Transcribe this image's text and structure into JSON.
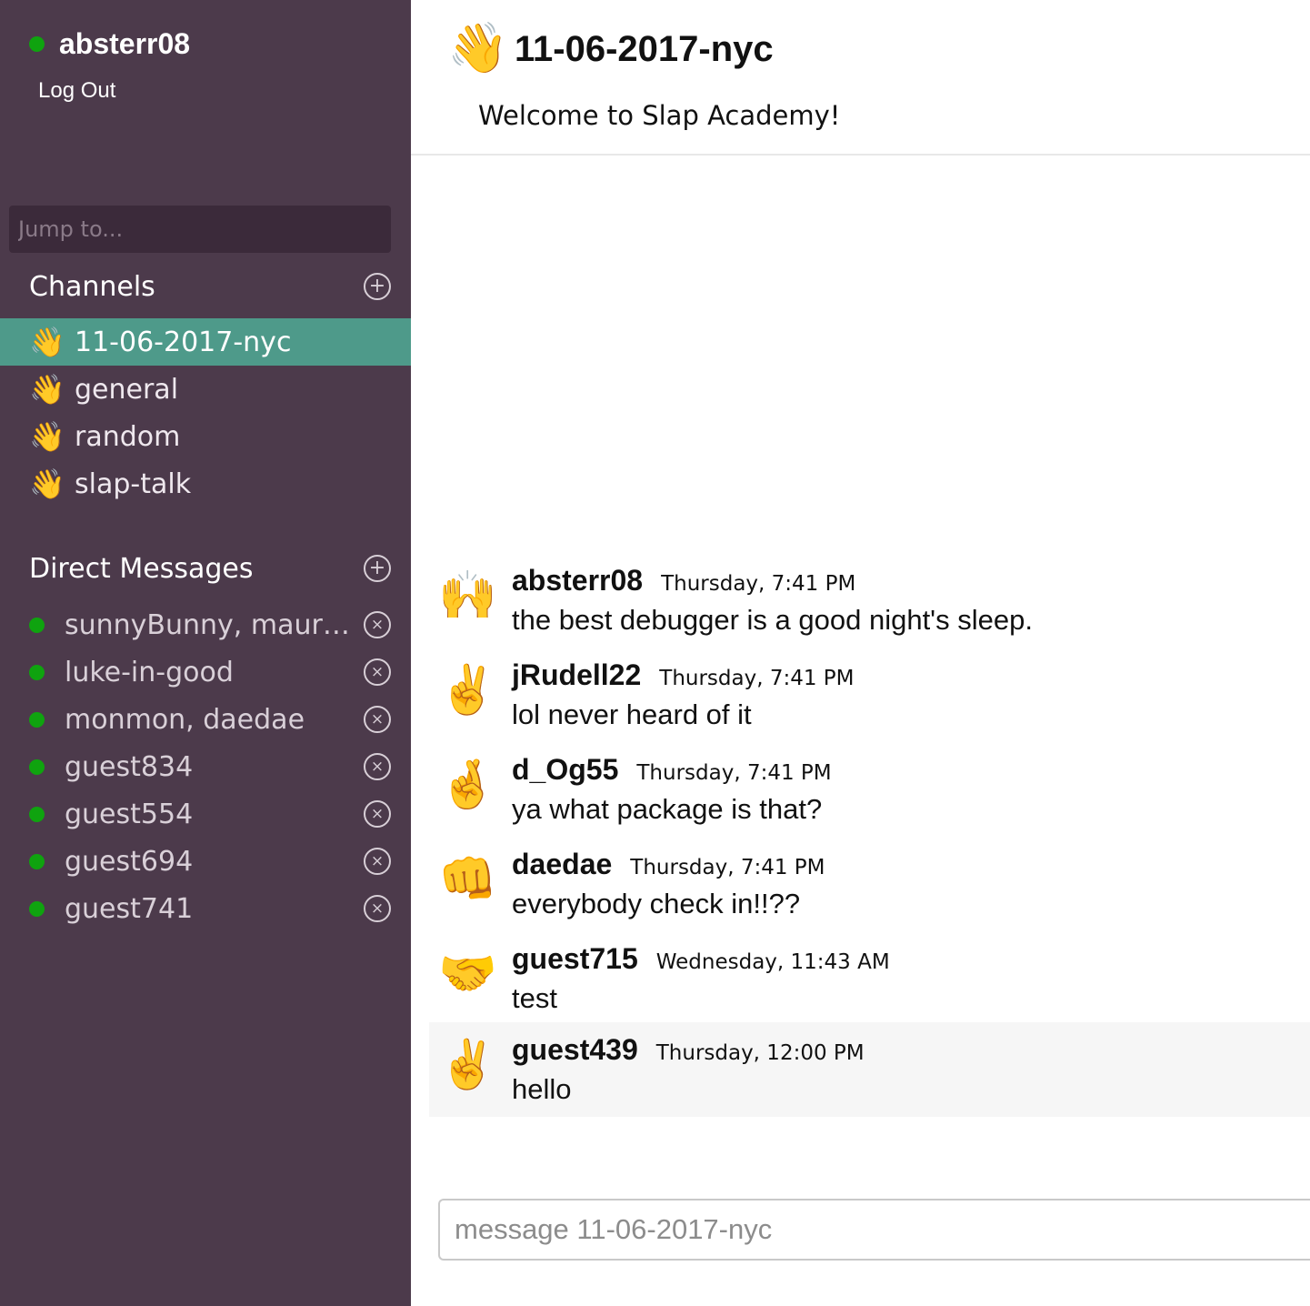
{
  "sidebar": {
    "username": "absterr08",
    "logout_label": "Log Out",
    "jump_placeholder": "Jump to...",
    "channels_title": "Channels",
    "add_icon": "+",
    "wave_emoji": "👋",
    "channels": [
      {
        "name": "11-06-2017-nyc",
        "active": true
      },
      {
        "name": "general"
      },
      {
        "name": "random"
      },
      {
        "name": "slap-talk"
      }
    ],
    "dms_title": "Direct Messages",
    "close_icon": "×",
    "direct_messages": [
      {
        "name": "sunnyBunny, mauric..."
      },
      {
        "name": "luke-in-good"
      },
      {
        "name": "monmon, daedae"
      },
      {
        "name": "guest834"
      },
      {
        "name": "guest554"
      },
      {
        "name": "guest694"
      },
      {
        "name": "guest741"
      }
    ],
    "colors": {
      "background": "#4c3a4b",
      "active_channel": "#4e9a8a",
      "presence_online": "#0fa30f"
    }
  },
  "main": {
    "header": {
      "emoji": "👋",
      "title": "11-06-2017-nyc",
      "topic": "Welcome to Slap Academy!"
    },
    "messages": [
      {
        "avatar": "🙌",
        "user": "absterr08",
        "time": "Thursday, 7:41 PM",
        "text": "the best debugger is a good night's sleep."
      },
      {
        "avatar": "✌️",
        "user": "jRudell22",
        "time": "Thursday, 7:41 PM",
        "text": "lol never heard of it"
      },
      {
        "avatar": "🤞",
        "user": "d_Og55",
        "time": "Thursday, 7:41 PM",
        "text": "ya what package is that?"
      },
      {
        "avatar": "👊",
        "user": "daedae",
        "time": "Thursday, 7:41 PM",
        "text": "everybody check in!!??"
      },
      {
        "avatar": "🤝",
        "user": "guest715",
        "time": "Wednesday, 11:43 AM",
        "text": "test"
      },
      {
        "avatar": "✌️",
        "user": "guest439",
        "time": "Thursday, 12:00 PM",
        "text": "hello"
      }
    ],
    "composer_placeholder": "message 11-06-2017-nyc"
  }
}
